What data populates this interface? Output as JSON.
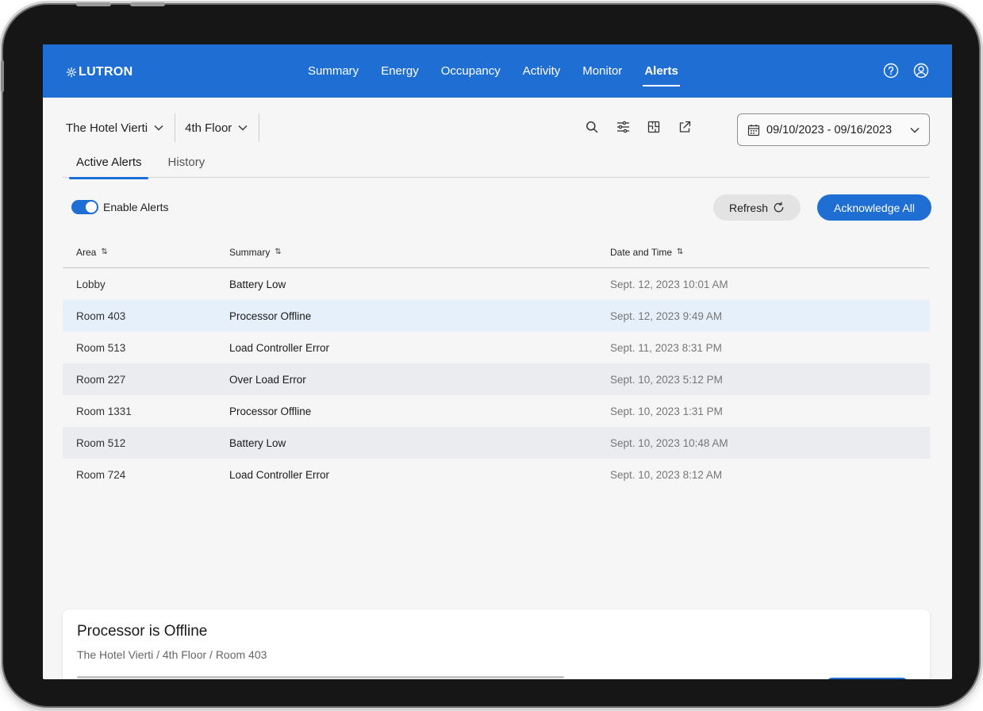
{
  "brand": {
    "name": "LUTRON"
  },
  "nav": {
    "items": [
      {
        "label": "Summary",
        "active": false
      },
      {
        "label": "Energy",
        "active": false
      },
      {
        "label": "Occupancy",
        "active": false
      },
      {
        "label": "Activity",
        "active": false
      },
      {
        "label": "Monitor",
        "active": false
      },
      {
        "label": "Alerts",
        "active": true
      }
    ],
    "icons": [
      "help-icon",
      "account-icon"
    ]
  },
  "selectors": {
    "property": "The Hotel Vierti",
    "floor": "4th Floor"
  },
  "toolbar": {
    "icons": [
      "search-icon",
      "filter-icon",
      "floorplan-icon",
      "share-icon"
    ],
    "date_range": "09/10/2023 - 09/16/2023"
  },
  "tabs": [
    {
      "label": "Active Alerts",
      "active": true
    },
    {
      "label": "History",
      "active": false
    }
  ],
  "controls": {
    "enable_alerts_label": "Enable Alerts",
    "enable_alerts_on": true,
    "refresh_label": "Refresh",
    "acknowledge_all_label": "Acknowledge All"
  },
  "table": {
    "columns": [
      "Area",
      "Summary",
      "Date and Time"
    ],
    "rows": [
      {
        "area": "Lobby",
        "summary": "Battery Low",
        "datetime": "Sept. 12, 2023 10:01 AM",
        "selected": false
      },
      {
        "area": "Room 403",
        "summary": "Processor Offline",
        "datetime": "Sept. 12, 2023 9:49 AM",
        "selected": true
      },
      {
        "area": "Room 513",
        "summary": "Load Controller Error",
        "datetime": "Sept. 11, 2023 8:31 PM",
        "selected": false
      },
      {
        "area": "Room 227",
        "summary": "Over Load Error",
        "datetime": "Sept. 10, 2023 5:12 PM",
        "selected": false
      },
      {
        "area": "Room 1331",
        "summary": "Processor Offline",
        "datetime": "Sept. 10, 2023 1:31 PM",
        "selected": false
      },
      {
        "area": "Room 512",
        "summary": "Battery Low",
        "datetime": "Sept. 10, 2023 10:48 AM",
        "selected": false
      },
      {
        "area": "Room 724",
        "summary": "Load Controller Error",
        "datetime": "Sept. 10, 2023 8:12 AM",
        "selected": false
      }
    ]
  },
  "detail": {
    "title": "Processor is Offline",
    "path": "The Hotel Vierti / 4th Floor / Room 403"
  },
  "colors": {
    "accent": "#1f6ed4",
    "selected_row": "#e6f0fb",
    "stripe_row": "#eaecef"
  }
}
